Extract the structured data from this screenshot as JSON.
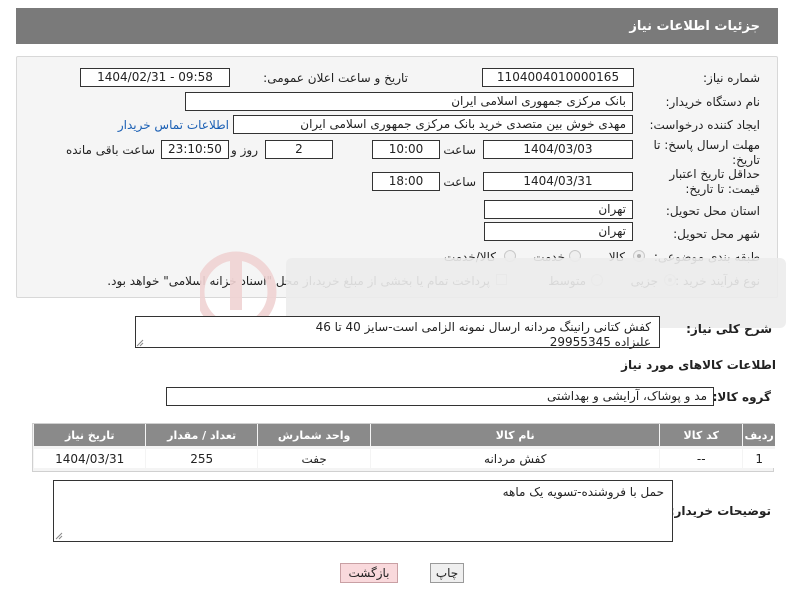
{
  "header": {
    "title": "جزئیات اطلاعات نیاز"
  },
  "form": {
    "need_number": {
      "label": "شماره نیاز:",
      "value": "1104004010000165"
    },
    "announce_datetime": {
      "label": "تاریخ و ساعت اعلان عمومی:",
      "value": "1404/02/31 - 09:58"
    },
    "buyer_org": {
      "label": "نام دستگاه خریدار:",
      "value": "بانک مرکزی جمهوری اسلامی ایران"
    },
    "requester": {
      "label": "ایجاد کننده درخواست:",
      "value": "مهدی خوش بین متصدی خرید بانک مرکزی جمهوری اسلامی ایران",
      "contact_link": "اطلاعات تماس خریدار"
    },
    "reply_deadline": {
      "label": "مهلت ارسال پاسخ: تا تاریخ:",
      "date": "1404/03/03",
      "time_label": "ساعت",
      "time": "10:00",
      "days": "2",
      "days_label": "روز و",
      "remaining": "23:10:50",
      "remaining_label": "ساعت باقی مانده"
    },
    "price_validity": {
      "label": "حداقل تاریخ اعتبار قیمت: تا تاریخ:",
      "date": "1404/03/31",
      "time_label": "ساعت",
      "time": "18:00"
    },
    "delivery_province": {
      "label": "استان محل تحویل:",
      "value": "تهران"
    },
    "delivery_city": {
      "label": "شهر محل تحویل:",
      "value": "تهران"
    },
    "category": {
      "label": "طبقه بندی موضوعی:",
      "options": [
        "کالا",
        "خدمت",
        "کالا/خدمت"
      ],
      "selected": "کالا"
    },
    "process": {
      "label": "نوع فرآیند خرید :",
      "options": [
        "جزیی",
        "متوسط"
      ],
      "selected": "جزیی",
      "payment_note": "پرداخت تمام یا بخشی از مبلغ خرید،از محل \"اسناد خزانه اسلامی\" خواهد بود."
    }
  },
  "need_summary": {
    "label": "شرح کلی نیاز:",
    "line1": "کفش کتانی رانینگ مردانه ارسال نمونه الزامی است-سایز 40 تا 46",
    "line2": "علیزاده 29955345"
  },
  "goods_info": {
    "heading": "اطلاعات کالاهای مورد نیاز"
  },
  "goods_group": {
    "label": "گروه کالا:",
    "value": "مد و پوشاک، آرایشی و بهداشتی"
  },
  "table": {
    "headers": [
      "ردیف",
      "کد کالا",
      "نام کالا",
      "واحد شمارش",
      "تعداد / مقدار",
      "تاریخ نیاز"
    ],
    "rows": [
      [
        "1",
        "--",
        "کفش مردانه",
        "جفت",
        "255",
        "1404/03/31"
      ]
    ]
  },
  "buyer_notes": {
    "label": "توضیحات خریدار:",
    "value": "حمل با فروشنده-تسویه یک ماهه"
  },
  "buttons": {
    "print": "چاپ",
    "back": "بازگشت"
  },
  "colors": {
    "header_bg": "#7a7a7a",
    "table_header_bg": "#8a8a8a",
    "link": "#1a5fb4",
    "back_button_bg": "#f9d9dc"
  }
}
